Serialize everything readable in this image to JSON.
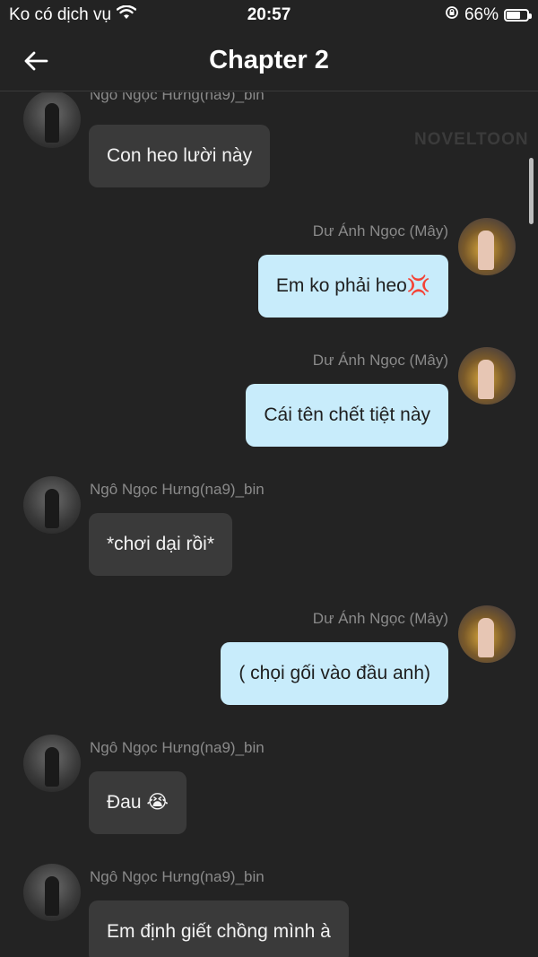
{
  "status": {
    "carrier": "Ko có dịch vụ",
    "time": "20:57",
    "battery": "66%",
    "battery_level": 0.66
  },
  "header": {
    "title": "Chapter 2"
  },
  "watermark": "NOVELTOON",
  "messages": [
    {
      "side": "left",
      "sender": "Ngô Ngọc Hưng(na9)_bin",
      "text": "Con heo lười này"
    },
    {
      "side": "right",
      "sender": "Dư Ánh Ngọc (Mây)",
      "text": "Em ko phải heo💢"
    },
    {
      "side": "right",
      "sender": "Dư Ánh Ngọc (Mây)",
      "text": "Cái tên chết tiệt này"
    },
    {
      "side": "left",
      "sender": "Ngô Ngọc Hưng(na9)_bin",
      "text": "*chơi dại rồi*"
    },
    {
      "side": "right",
      "sender": "Dư Ánh Ngọc (Mây)",
      "text": "( chọi gối vào đầu anh)"
    },
    {
      "side": "left",
      "sender": "Ngô Ngọc Hưng(na9)_bin",
      "text": "Đau 😭"
    },
    {
      "side": "left",
      "sender": "Ngô Ngọc Hưng(na9)_bin",
      "text": "Em định giết chồng mình à"
    }
  ]
}
